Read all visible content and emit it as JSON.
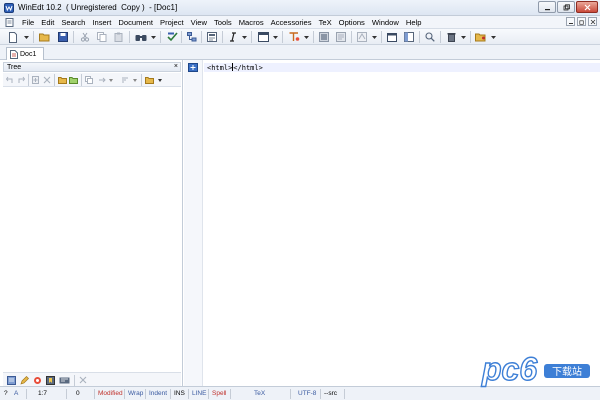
{
  "window": {
    "title": "WinEdt 10.2  ( Unregistered  Copy )  - [Doc1]"
  },
  "menu": {
    "items": [
      "File",
      "Edit",
      "Search",
      "Insert",
      "Document",
      "Project",
      "View",
      "Tools",
      "Macros",
      "Accessories",
      "TeX",
      "Options",
      "Window",
      "Help"
    ]
  },
  "tabs": {
    "documents": [
      {
        "label": "Doc1",
        "active": true
      }
    ]
  },
  "tree": {
    "title": "Tree",
    "close_glyph": "×"
  },
  "editor": {
    "before_caret": "<html>",
    "after_caret": "</html>"
  },
  "status": {
    "cells": [
      "?",
      "A",
      "1:7",
      "0",
      "Modified",
      "Wrap",
      "Indent",
      "INS",
      "LINE",
      "Spell",
      "TeX",
      "UTF-8",
      "--src"
    ]
  },
  "watermark": {
    "logo_text": "pc6",
    "caption": "下载站"
  },
  "colors": {
    "title_bar": "#dde6f2",
    "menu_bar": "#f2f5fa",
    "status_red": "#c0302a",
    "status_blue": "#3a5aa0",
    "close_button": "#c9493a",
    "watermark_blue": "#3d7fd6"
  },
  "icons": [
    "winedt-app-icon",
    "new-document-icon",
    "open-folder-icon",
    "save-icon",
    "cut-icon",
    "copy-icon",
    "paste-icon",
    "find-icon",
    "spell-check-icon",
    "project-tree-icon",
    "italic-icon",
    "tex-icon",
    "search-icon",
    "delete-icon",
    "bookmark-icon"
  ]
}
